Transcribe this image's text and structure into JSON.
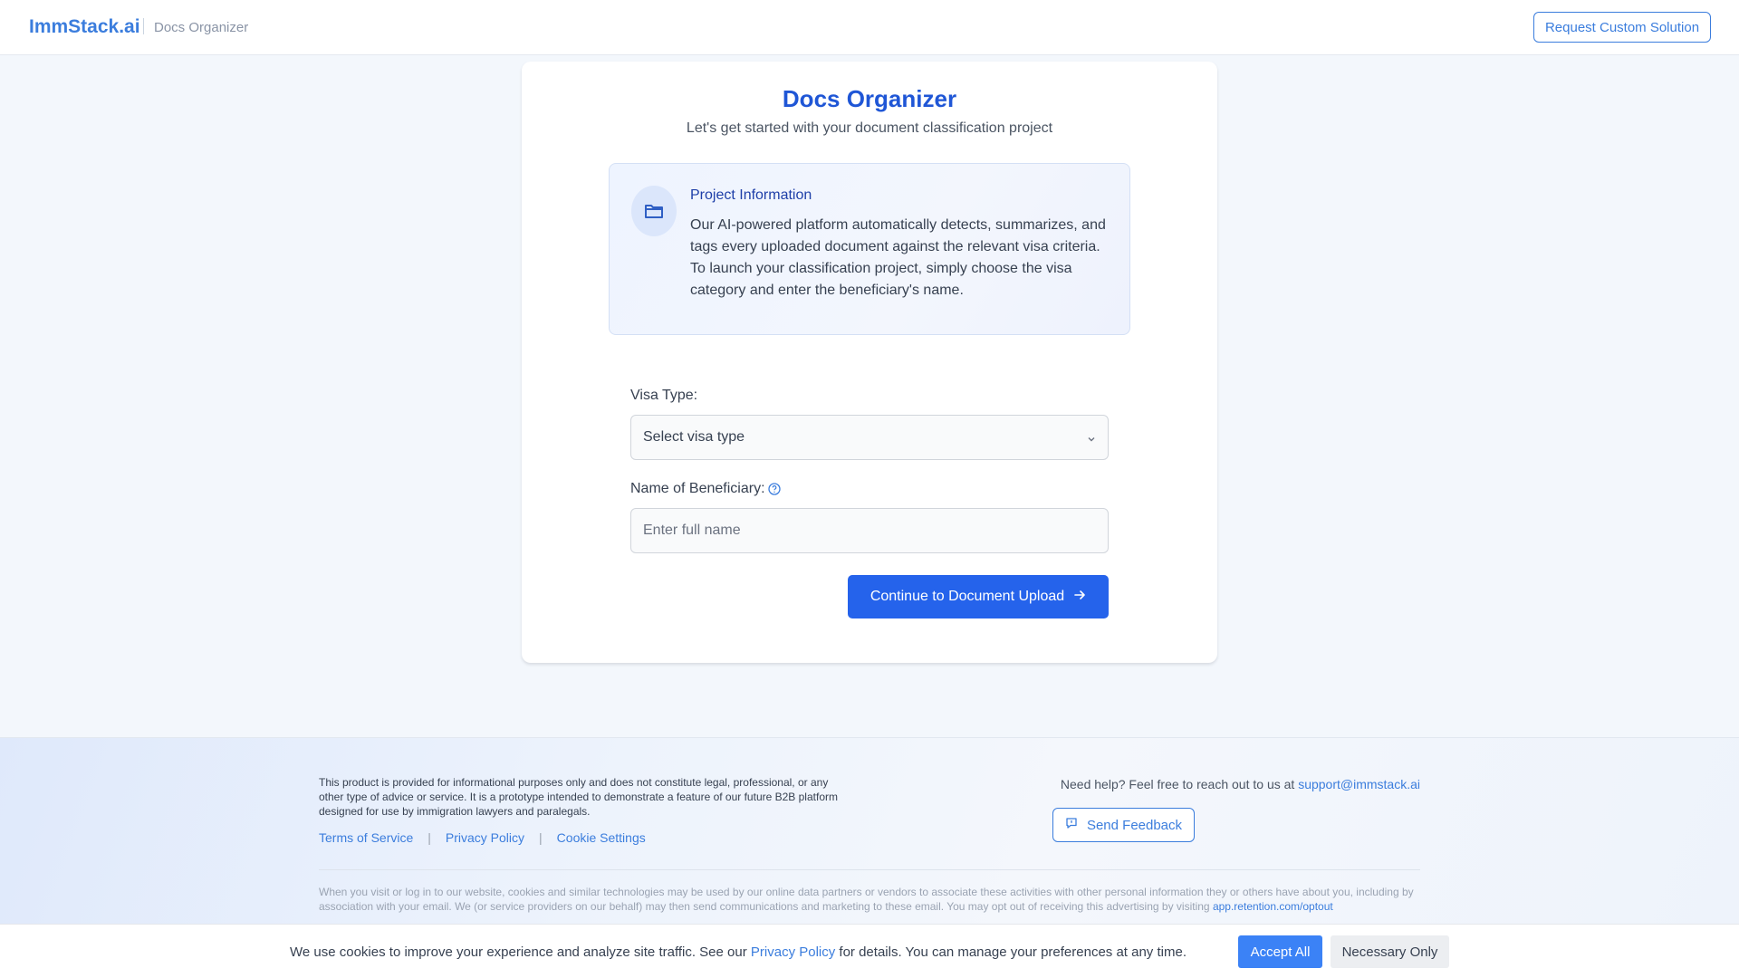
{
  "header": {
    "brand": "ImmStack.ai",
    "subtitle": "Docs Organizer",
    "custom_solution_label": "Request Custom Solution"
  },
  "card": {
    "title": "Docs Organizer",
    "subtitle": "Let's get started with your document classification project",
    "info": {
      "icon": "folder-icon",
      "title": "Project Information",
      "text": "Our AI-powered platform automatically detects, summarizes, and tags every uploaded document against the relevant visa criteria. To launch your classification project, simply choose the visa category and enter the beneficiary's name."
    },
    "form": {
      "visa_label": "Visa Type:",
      "visa_value": "Select visa type",
      "name_label": "Name of Beneficiary:",
      "name_placeholder": "Enter full name",
      "continue_label": "Continue to Document Upload"
    }
  },
  "footer": {
    "disclaimer": "This product is provided for informational purposes only and does not constitute legal, professional, or any other type of advice or service. It is a prototype intended to demonstrate a feature of our future B2B platform designed for use by immigration lawyers and paralegals.",
    "links": [
      "Terms of Service",
      "Privacy Policy",
      "Cookie Settings"
    ],
    "help_text": "Need help? Feel free to reach out to us at",
    "help_email": "support@immstack.ai",
    "feedback_label": "Send Feedback",
    "cookie_notice": "When you visit or log in to our website, cookies and similar technologies may be used by our online data partners or vendors to associate these activities with other personal information they or others have about you, including by association with your email. We (or service providers on our behalf) may then send communications and marketing to these email. You may opt out of receiving this advertising by visiting",
    "optout_link": "app.retention.com/optout"
  },
  "cookie_bar": {
    "text_before": "We use cookies to improve your experience and analyze site traffic. See our",
    "policy_link": "Privacy Policy",
    "text_after": "for details. You can manage your preferences at any time.",
    "accept_label": "Accept All",
    "necessary_label": "Necessary Only"
  },
  "colors": {
    "brand": "#3b7ddd",
    "primary_button": "#2563eb",
    "title": "#1f56d6"
  }
}
